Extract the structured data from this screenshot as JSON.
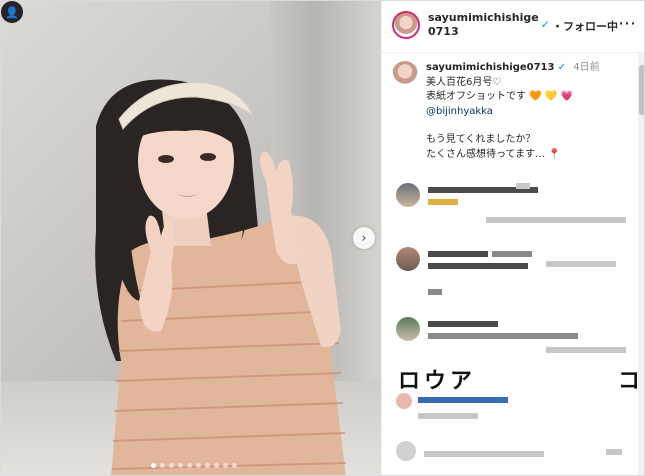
{
  "post": {
    "username": "sayumimichishige0713",
    "verified_badge": "✓",
    "follow_label": "・フォロー中",
    "more_icon": "more-horizontal-icon",
    "caption_username": "sayumimichishige0713",
    "caption_time": "4日前",
    "caption_line1": "美人百花6月号♡",
    "caption_line2": "表紙オフショットです",
    "caption_hearts": [
      "🧡",
      "💛",
      "💗"
    ],
    "caption_mention": "@bijinhyakka",
    "caption_line3": "もう見てくれましたか？",
    "caption_line4": "たくさん感想待ってます…",
    "caption_end_icon": "📍"
  },
  "media": {
    "slide_count": 10,
    "active_slide": 0,
    "next_icon": "›",
    "tag_icon": "👤"
  },
  "comments_obscured": {
    "glyph_row": "ロウア",
    "glyph_end": "コ"
  },
  "colors": {
    "verified": "#0095f6",
    "story_ring": "#d62976",
    "mention": "#00376b"
  }
}
